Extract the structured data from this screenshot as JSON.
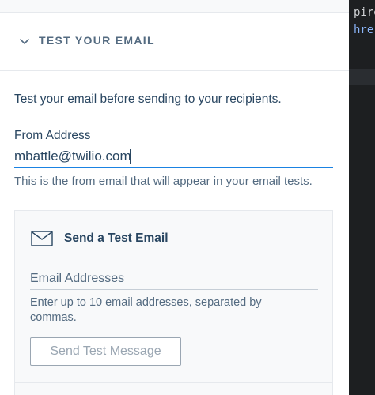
{
  "section": {
    "title": "TEST YOUR EMAIL",
    "intro": "Test your email before sending to your recipients."
  },
  "from": {
    "label": "From Address",
    "value": "mbattle@twilio.com",
    "help": "This is the from email that will appear in your email tests."
  },
  "test_card": {
    "title": "Send a Test Email",
    "emails_placeholder": "Email Addresses",
    "emails_help": "Enter up to 10 email addresses, separated by commas.",
    "send_label": "Send Test Message"
  },
  "code": {
    "line1": "pire",
    "line2": "hre"
  },
  "colors": {
    "accent": "#1a82e2",
    "text": "#294661",
    "muted": "#546b81",
    "code_bg": "#1d1f21"
  },
  "icons": [
    "chevron-down-icon",
    "envelope-icon"
  ]
}
